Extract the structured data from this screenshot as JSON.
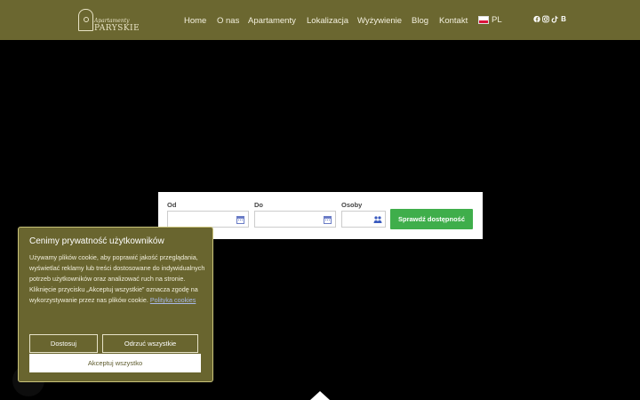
{
  "header": {
    "logo": {
      "script": "Apartamenty",
      "brand": "PARYSKIE"
    },
    "nav": [
      "Home",
      "O nas",
      "Apartamenty",
      "Lokalizacja",
      "Wyżywienie",
      "Blog",
      "Kontakt"
    ],
    "language": "PL",
    "socials": [
      "facebook-icon",
      "instagram-icon",
      "tiktok-icon",
      "booking-icon"
    ],
    "booking_letter": "B"
  },
  "booking": {
    "from_label": "Od",
    "to_label": "Do",
    "guests_label": "Osoby",
    "check_button": "Sprawdź dostępność"
  },
  "cookie": {
    "title": "Cenimy prywatność użytkowników",
    "body": "Używamy plików cookie, aby poprawić jakość przeglądania, wyświetlać reklamy lub treści dostosowane do indywidualnych potrzeb użytkowników oraz analizować ruch na stronie. Kliknięcie przycisku „Akceptuj wszystkie” oznacza zgodę na wykorzystywanie przez nas plików cookie.",
    "policy_link": "Polityka cookies",
    "customize": "Dostosuj",
    "reject": "Odrzuć wszystkie",
    "accept": "Akceptuj wszystko"
  },
  "colors": {
    "header_bg": "#6b6730",
    "button_green": "#3fae4b",
    "cookie_bg": "#69652f"
  }
}
